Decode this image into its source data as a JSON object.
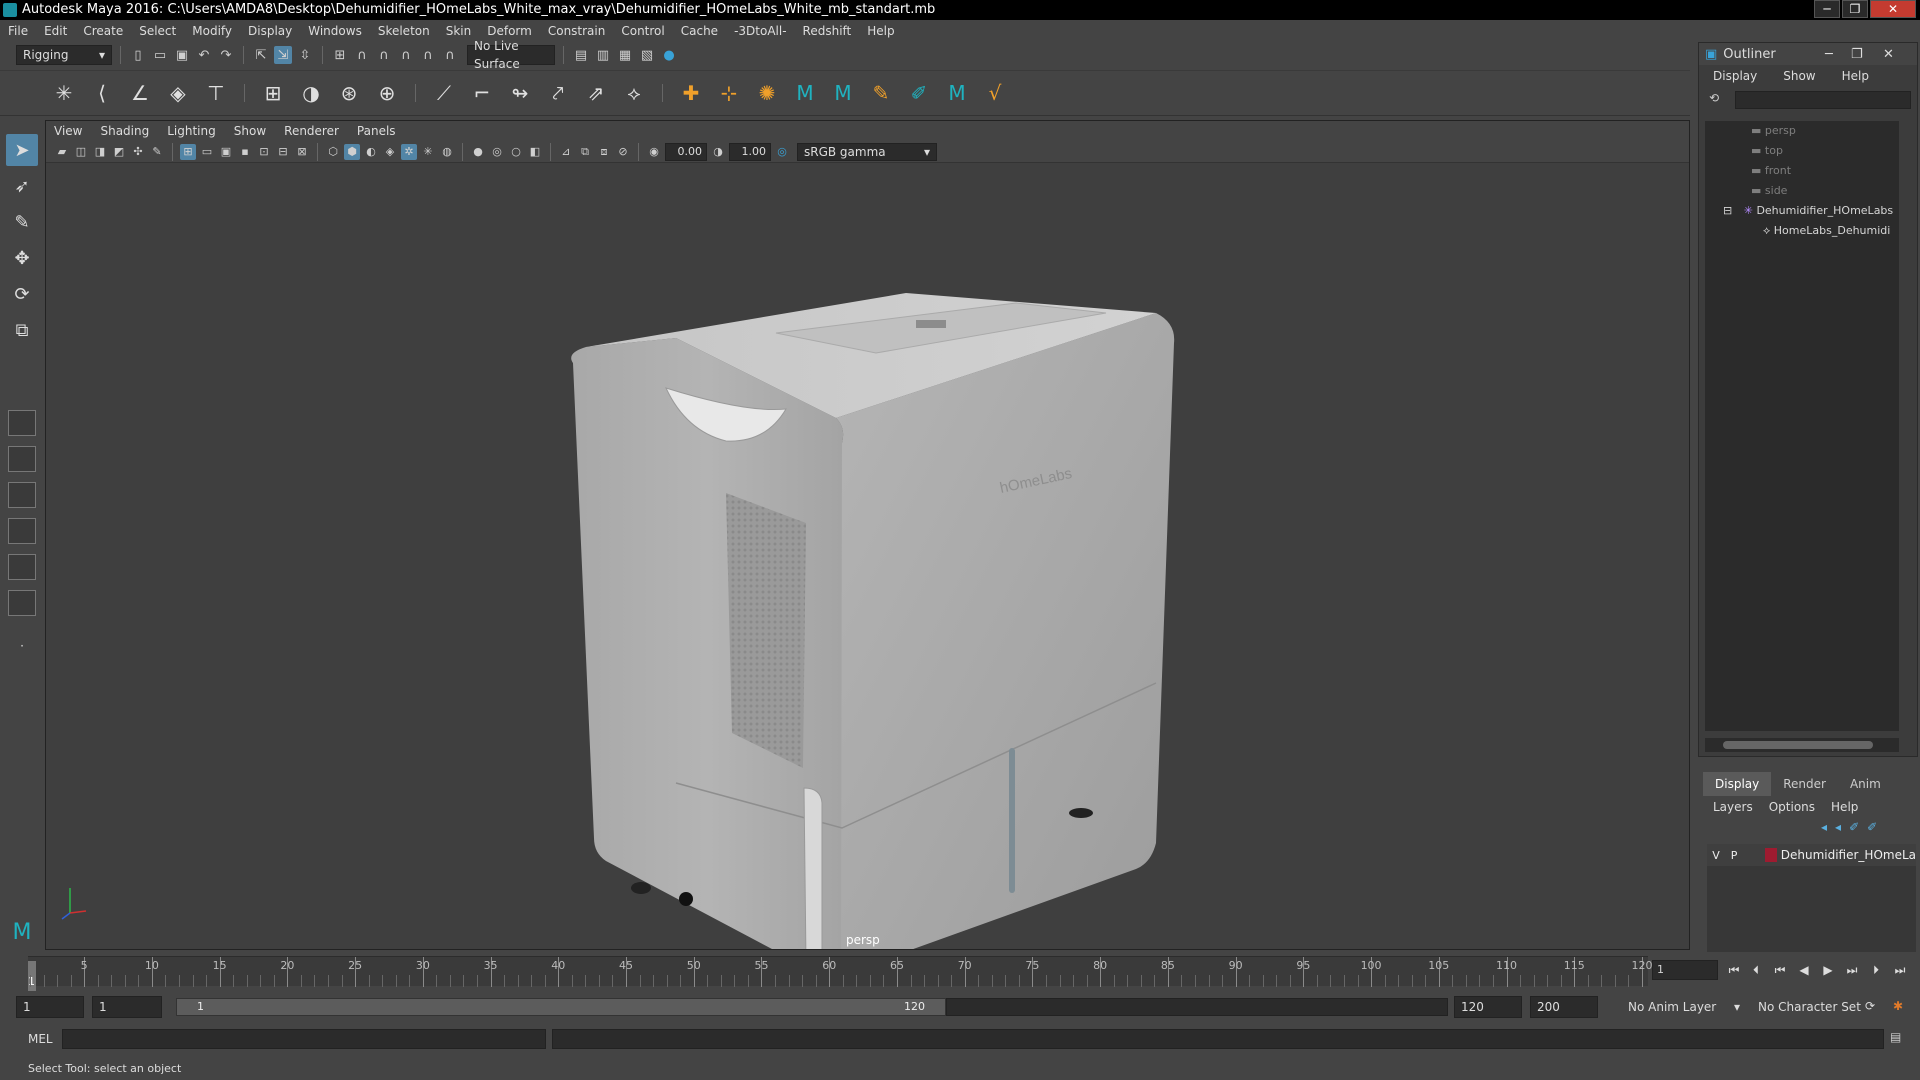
{
  "window": {
    "title": "Autodesk Maya 2016: C:\\Users\\AMDA8\\Desktop\\Dehumidifier_HOmeLabs_White_max_vray\\Dehumidifier_HOmeLabs_White_mb_standart.mb",
    "minimize": "─",
    "maximize": "❐",
    "close": "✕"
  },
  "menubar": [
    "File",
    "Edit",
    "Create",
    "Select",
    "Modify",
    "Display",
    "Windows",
    "Skeleton",
    "Skin",
    "Deform",
    "Constrain",
    "Control",
    "Cache",
    "-3DtoAll-",
    "Redshift",
    "Help"
  ],
  "statusline": {
    "menuset": "Rigging",
    "live_surface": "No Live Surface"
  },
  "viewport": {
    "menu": [
      "View",
      "Shading",
      "Lighting",
      "Show",
      "Renderer",
      "Panels"
    ],
    "exposure": "0.00",
    "gamma": "1.00",
    "color_space": "sRGB gamma",
    "camera": "persp",
    "model_brand": "hOmeLabs"
  },
  "outliner": {
    "title": "Outliner",
    "menu": [
      "Display",
      "Show",
      "Help"
    ],
    "items": [
      {
        "label": "persp",
        "dim": true
      },
      {
        "label": "top",
        "dim": true
      },
      {
        "label": "front",
        "dim": true
      },
      {
        "label": "side",
        "dim": true
      },
      {
        "label": "Dehumidifier_HOmeLabs",
        "dim": false
      },
      {
        "label": "HomeLabs_Dehumidi",
        "dim": false
      }
    ]
  },
  "layers": {
    "tabs": [
      "Display",
      "Render",
      "Anim"
    ],
    "active_tab": "Display",
    "menu": [
      "Layers",
      "Options",
      "Help"
    ],
    "rows": [
      {
        "v": "V",
        "p": "P",
        "name": "Dehumidifier_HOmeLa",
        "color": "#9e1b30"
      }
    ]
  },
  "timeline": {
    "tick_labels": [
      "5",
      "10",
      "15",
      "20",
      "25",
      "30",
      "35",
      "40",
      "45",
      "50",
      "55",
      "60",
      "65",
      "70",
      "75",
      "80",
      "85",
      "90",
      "95",
      "100",
      "105",
      "110",
      "115",
      "120"
    ],
    "current_frame": "1",
    "current_frame_field": "1"
  },
  "range": {
    "start": "1",
    "playback_start": "1",
    "slider_start": "1",
    "slider_end": "120",
    "playback_end": "120",
    "end": "200",
    "anim_layer": "No Anim Layer",
    "character_set": "No Character Set"
  },
  "command": {
    "mode": "MEL",
    "help": "Select Tool: select an object"
  }
}
